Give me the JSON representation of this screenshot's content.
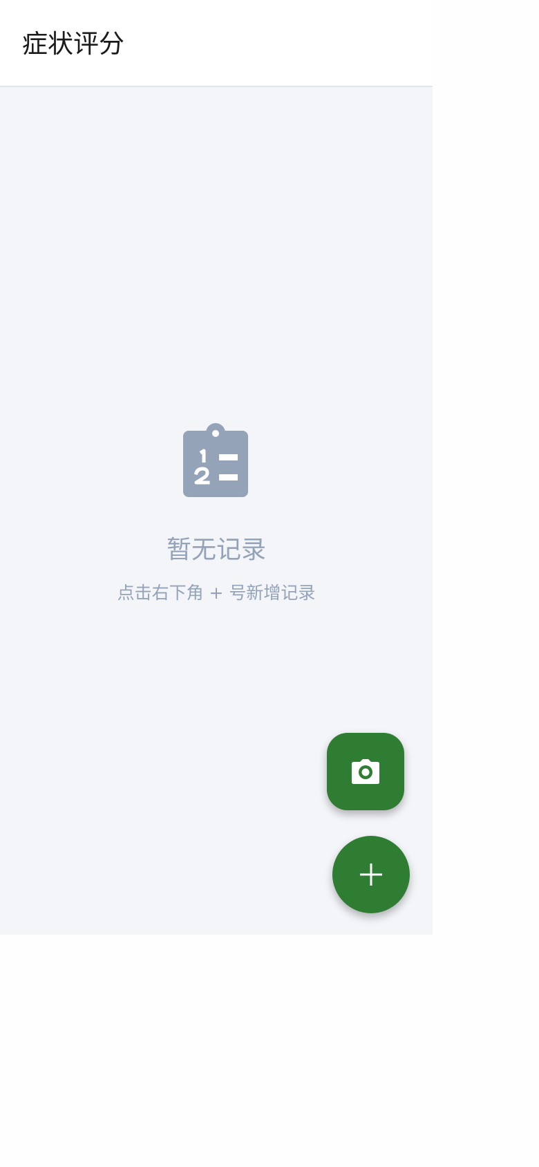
{
  "header": {
    "title": "症状评分"
  },
  "empty_state": {
    "icon": "clipboard-list-icon",
    "title": "暂无记录",
    "hint": "点击右下角 + 号新增记录"
  },
  "actions": {
    "camera_icon": "camera-icon",
    "add_icon": "plus-icon"
  },
  "colors": {
    "accent": "#2e7d32",
    "muted_text": "#94a3b8",
    "background": "#f3f5f9",
    "header_background": "#ffffff"
  }
}
